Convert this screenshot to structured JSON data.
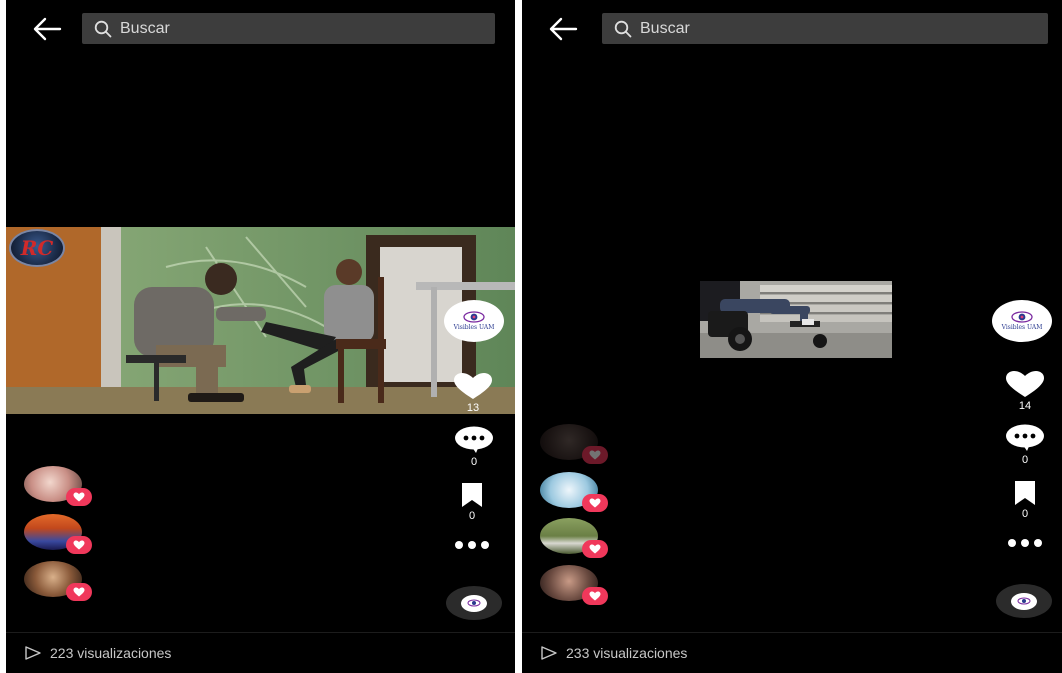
{
  "screens": [
    {
      "search": {
        "placeholder": "Buscar"
      },
      "overlay_badge": {
        "text": "RC"
      },
      "account": {
        "name": "Visibles UAM"
      },
      "likes": "13",
      "comments": "0",
      "saves": "0",
      "views": "223 visualizaciones"
    },
    {
      "search": {
        "placeholder": "Buscar"
      },
      "account": {
        "name": "Visibles UAM"
      },
      "likes": "14",
      "comments": "0",
      "saves": "0",
      "views": "233 visualizaciones"
    }
  ],
  "colors": {
    "background": "#000000",
    "search_bg": "#3d3d3d",
    "accent_heart": "#f0385b",
    "icon_white": "#ffffff"
  },
  "icons": [
    "back-arrow-icon",
    "search-icon",
    "heart-icon",
    "comment-icon",
    "bookmark-icon",
    "more-icon",
    "music-disc-icon",
    "play-outline-icon"
  ]
}
